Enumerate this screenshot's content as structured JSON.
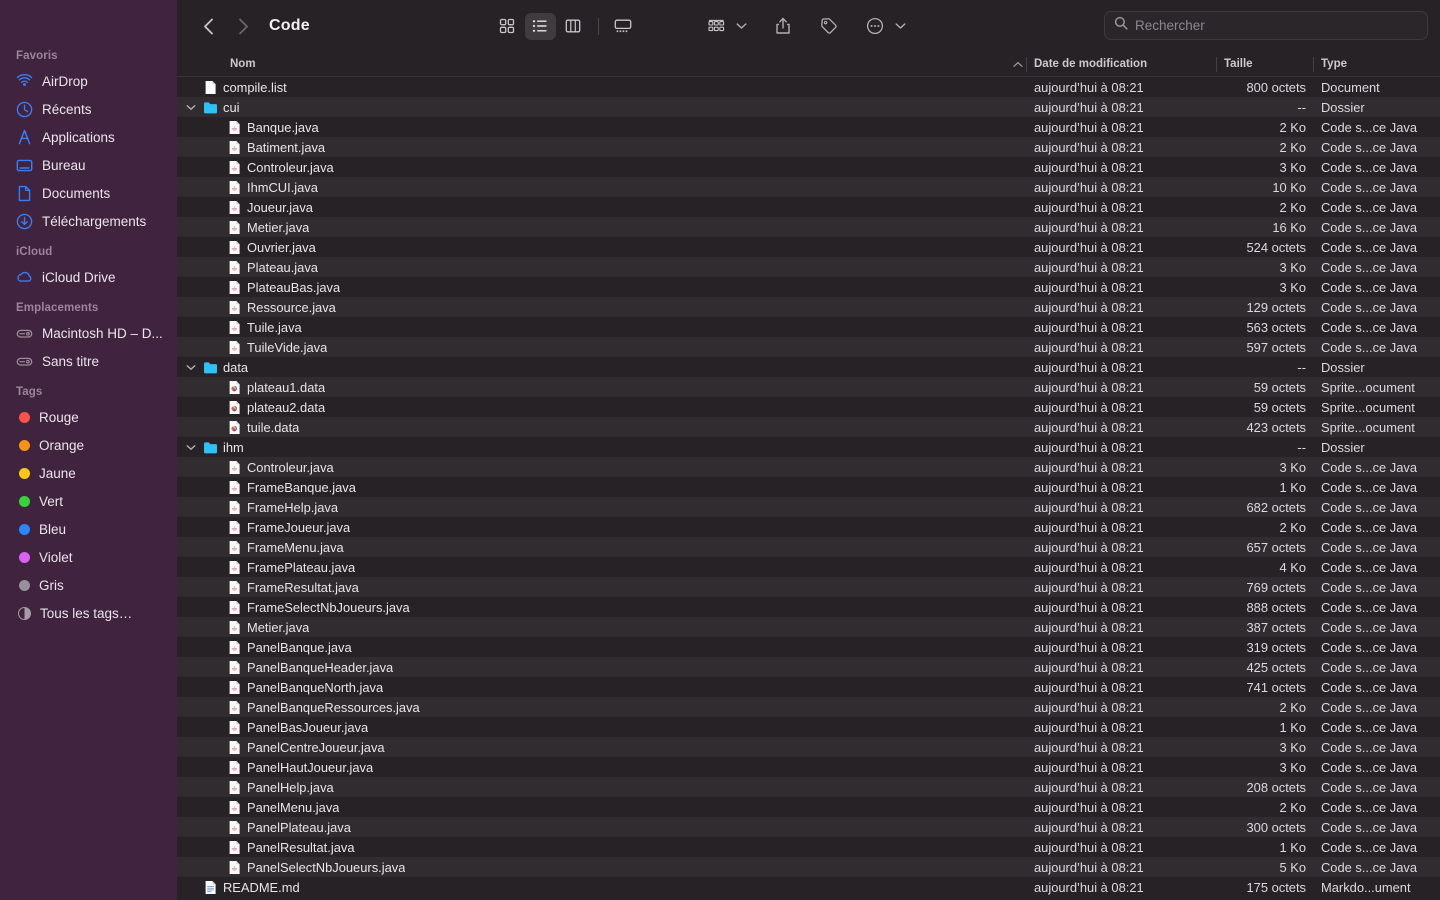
{
  "window": {
    "title": "Code",
    "nav": {
      "back_label": "Précédent",
      "forward_label": "Suivant"
    }
  },
  "toolbar": {
    "view_icon": "icon-view",
    "view_list": "list-view",
    "view_column": "column-view",
    "view_gallery": "gallery-view",
    "group_label": "group-by",
    "share_label": "share",
    "tag_label": "tags",
    "more_label": "more-actions"
  },
  "search": {
    "placeholder": "Rechercher",
    "value": ""
  },
  "sidebar": {
    "sections": [
      {
        "title": "Favoris",
        "items": [
          {
            "label": "AirDrop",
            "icon": "airdrop-icon"
          },
          {
            "label": "Récents",
            "icon": "clock-icon"
          },
          {
            "label": "Applications",
            "icon": "applications-icon"
          },
          {
            "label": "Bureau",
            "icon": "desktop-icon"
          },
          {
            "label": "Documents",
            "icon": "document-icon"
          },
          {
            "label": "Téléchargements",
            "icon": "downloads-icon"
          }
        ]
      },
      {
        "title": "iCloud",
        "items": [
          {
            "label": "iCloud Drive",
            "icon": "cloud-icon"
          }
        ]
      },
      {
        "title": "Emplacements",
        "items": [
          {
            "label": "Macintosh HD – D...",
            "icon": "harddisk-icon"
          },
          {
            "label": "Sans titre",
            "icon": "harddisk-icon"
          }
        ]
      },
      {
        "title": "Tags",
        "items": [
          {
            "label": "Rouge",
            "icon": "tag-dot",
            "color": "#F8544F"
          },
          {
            "label": "Orange",
            "icon": "tag-dot",
            "color": "#F5921B"
          },
          {
            "label": "Jaune",
            "icon": "tag-dot",
            "color": "#FCC717"
          },
          {
            "label": "Vert",
            "icon": "tag-dot",
            "color": "#3BD13B"
          },
          {
            "label": "Bleu",
            "icon": "tag-dot",
            "color": "#2D87F8"
          },
          {
            "label": "Violet",
            "icon": "tag-dot",
            "color": "#D763F0"
          },
          {
            "label": "Gris",
            "icon": "tag-dot",
            "color": "#98909A"
          },
          {
            "label": "Tous les tags…",
            "icon": "all-tags-icon",
            "color": ""
          }
        ]
      }
    ]
  },
  "columns": {
    "name": "Nom",
    "date": "Date de modification",
    "size": "Taille",
    "type": "Type",
    "sort_direction": "ascending"
  },
  "files": [
    {
      "name": "compile.list",
      "indent": 0,
      "kind": "file",
      "icon": "plain-file-icon",
      "date": "aujourd’hui à 08:21",
      "size": "800 octets",
      "type": "Document"
    },
    {
      "name": "cui",
      "indent": 0,
      "kind": "folder",
      "icon": "folder-icon",
      "date": "aujourd’hui à 08:21",
      "size": "--",
      "type": "Dossier",
      "expanded": true
    },
    {
      "name": "Banque.java",
      "indent": 1,
      "kind": "file",
      "icon": "java-file-icon",
      "date": "aujourd’hui à 08:21",
      "size": "2 Ko",
      "type": "Code s...ce Java"
    },
    {
      "name": "Batiment.java",
      "indent": 1,
      "kind": "file",
      "icon": "java-file-icon",
      "date": "aujourd’hui à 08:21",
      "size": "2 Ko",
      "type": "Code s...ce Java"
    },
    {
      "name": "Controleur.java",
      "indent": 1,
      "kind": "file",
      "icon": "java-file-icon",
      "date": "aujourd’hui à 08:21",
      "size": "3 Ko",
      "type": "Code s...ce Java"
    },
    {
      "name": "IhmCUI.java",
      "indent": 1,
      "kind": "file",
      "icon": "java-file-icon",
      "date": "aujourd’hui à 08:21",
      "size": "10 Ko",
      "type": "Code s...ce Java"
    },
    {
      "name": "Joueur.java",
      "indent": 1,
      "kind": "file",
      "icon": "java-file-icon",
      "date": "aujourd’hui à 08:21",
      "size": "2 Ko",
      "type": "Code s...ce Java"
    },
    {
      "name": "Metier.java",
      "indent": 1,
      "kind": "file",
      "icon": "java-file-icon",
      "date": "aujourd’hui à 08:21",
      "size": "16 Ko",
      "type": "Code s...ce Java"
    },
    {
      "name": "Ouvrier.java",
      "indent": 1,
      "kind": "file",
      "icon": "java-file-icon",
      "date": "aujourd’hui à 08:21",
      "size": "524 octets",
      "type": "Code s...ce Java"
    },
    {
      "name": "Plateau.java",
      "indent": 1,
      "kind": "file",
      "icon": "java-file-icon",
      "date": "aujourd’hui à 08:21",
      "size": "3 Ko",
      "type": "Code s...ce Java"
    },
    {
      "name": "PlateauBas.java",
      "indent": 1,
      "kind": "file",
      "icon": "java-file-icon",
      "date": "aujourd’hui à 08:21",
      "size": "3 Ko",
      "type": "Code s...ce Java"
    },
    {
      "name": "Ressource.java",
      "indent": 1,
      "kind": "file",
      "icon": "java-file-icon",
      "date": "aujourd’hui à 08:21",
      "size": "129 octets",
      "type": "Code s...ce Java"
    },
    {
      "name": "Tuile.java",
      "indent": 1,
      "kind": "file",
      "icon": "java-file-icon",
      "date": "aujourd’hui à 08:21",
      "size": "563 octets",
      "type": "Code s...ce Java"
    },
    {
      "name": "TuileVide.java",
      "indent": 1,
      "kind": "file",
      "icon": "java-file-icon",
      "date": "aujourd’hui à 08:21",
      "size": "597 octets",
      "type": "Code s...ce Java"
    },
    {
      "name": "data",
      "indent": 0,
      "kind": "folder",
      "icon": "folder-icon",
      "date": "aujourd’hui à 08:21",
      "size": "--",
      "type": "Dossier",
      "expanded": true
    },
    {
      "name": "plateau1.data",
      "indent": 1,
      "kind": "file",
      "icon": "sprite-file-icon",
      "date": "aujourd’hui à 08:21",
      "size": "59 octets",
      "type": "Sprite...ocument"
    },
    {
      "name": "plateau2.data",
      "indent": 1,
      "kind": "file",
      "icon": "sprite-file-icon",
      "date": "aujourd’hui à 08:21",
      "size": "59 octets",
      "type": "Sprite...ocument"
    },
    {
      "name": "tuile.data",
      "indent": 1,
      "kind": "file",
      "icon": "sprite-file-icon",
      "date": "aujourd’hui à 08:21",
      "size": "423 octets",
      "type": "Sprite...ocument"
    },
    {
      "name": "ihm",
      "indent": 0,
      "kind": "folder",
      "icon": "folder-icon",
      "date": "aujourd’hui à 08:21",
      "size": "--",
      "type": "Dossier",
      "expanded": true
    },
    {
      "name": "Controleur.java",
      "indent": 1,
      "kind": "file",
      "icon": "java-file-icon",
      "date": "aujourd’hui à 08:21",
      "size": "3 Ko",
      "type": "Code s...ce Java"
    },
    {
      "name": "FrameBanque.java",
      "indent": 1,
      "kind": "file",
      "icon": "java-file-icon",
      "date": "aujourd’hui à 08:21",
      "size": "1 Ko",
      "type": "Code s...ce Java"
    },
    {
      "name": "FrameHelp.java",
      "indent": 1,
      "kind": "file",
      "icon": "java-file-icon",
      "date": "aujourd’hui à 08:21",
      "size": "682 octets",
      "type": "Code s...ce Java"
    },
    {
      "name": "FrameJoueur.java",
      "indent": 1,
      "kind": "file",
      "icon": "java-file-icon",
      "date": "aujourd’hui à 08:21",
      "size": "2 Ko",
      "type": "Code s...ce Java"
    },
    {
      "name": "FrameMenu.java",
      "indent": 1,
      "kind": "file",
      "icon": "java-file-icon",
      "date": "aujourd’hui à 08:21",
      "size": "657 octets",
      "type": "Code s...ce Java"
    },
    {
      "name": "FramePlateau.java",
      "indent": 1,
      "kind": "file",
      "icon": "java-file-icon",
      "date": "aujourd’hui à 08:21",
      "size": "4 Ko",
      "type": "Code s...ce Java"
    },
    {
      "name": "FrameResultat.java",
      "indent": 1,
      "kind": "file",
      "icon": "java-file-icon",
      "date": "aujourd’hui à 08:21",
      "size": "769 octets",
      "type": "Code s...ce Java"
    },
    {
      "name": "FrameSelectNbJoueurs.java",
      "indent": 1,
      "kind": "file",
      "icon": "java-file-icon",
      "date": "aujourd’hui à 08:21",
      "size": "888 octets",
      "type": "Code s...ce Java"
    },
    {
      "name": "Metier.java",
      "indent": 1,
      "kind": "file",
      "icon": "java-file-icon",
      "date": "aujourd’hui à 08:21",
      "size": "387 octets",
      "type": "Code s...ce Java"
    },
    {
      "name": "PanelBanque.java",
      "indent": 1,
      "kind": "file",
      "icon": "java-file-icon",
      "date": "aujourd’hui à 08:21",
      "size": "319 octets",
      "type": "Code s...ce Java"
    },
    {
      "name": "PanelBanqueHeader.java",
      "indent": 1,
      "kind": "file",
      "icon": "java-file-icon",
      "date": "aujourd’hui à 08:21",
      "size": "425 octets",
      "type": "Code s...ce Java"
    },
    {
      "name": "PanelBanqueNorth.java",
      "indent": 1,
      "kind": "file",
      "icon": "java-file-icon",
      "date": "aujourd’hui à 08:21",
      "size": "741 octets",
      "type": "Code s...ce Java"
    },
    {
      "name": "PanelBanqueRessources.java",
      "indent": 1,
      "kind": "file",
      "icon": "java-file-icon",
      "date": "aujourd’hui à 08:21",
      "size": "2 Ko",
      "type": "Code s...ce Java"
    },
    {
      "name": "PanelBasJoueur.java",
      "indent": 1,
      "kind": "file",
      "icon": "java-file-icon",
      "date": "aujourd’hui à 08:21",
      "size": "1 Ko",
      "type": "Code s...ce Java"
    },
    {
      "name": "PanelCentreJoueur.java",
      "indent": 1,
      "kind": "file",
      "icon": "java-file-icon",
      "date": "aujourd’hui à 08:21",
      "size": "3 Ko",
      "type": "Code s...ce Java"
    },
    {
      "name": "PanelHautJoueur.java",
      "indent": 1,
      "kind": "file",
      "icon": "java-file-icon",
      "date": "aujourd’hui à 08:21",
      "size": "3 Ko",
      "type": "Code s...ce Java"
    },
    {
      "name": "PanelHelp.java",
      "indent": 1,
      "kind": "file",
      "icon": "java-file-icon",
      "date": "aujourd’hui à 08:21",
      "size": "208 octets",
      "type": "Code s...ce Java"
    },
    {
      "name": "PanelMenu.java",
      "indent": 1,
      "kind": "file",
      "icon": "java-file-icon",
      "date": "aujourd’hui à 08:21",
      "size": "2 Ko",
      "type": "Code s...ce Java"
    },
    {
      "name": "PanelPlateau.java",
      "indent": 1,
      "kind": "file",
      "icon": "java-file-icon",
      "date": "aujourd’hui à 08:21",
      "size": "300 octets",
      "type": "Code s...ce Java"
    },
    {
      "name": "PanelResultat.java",
      "indent": 1,
      "kind": "file",
      "icon": "java-file-icon",
      "date": "aujourd’hui à 08:21",
      "size": "1 Ko",
      "type": "Code s...ce Java"
    },
    {
      "name": "PanelSelectNbJoueurs.java",
      "indent": 1,
      "kind": "file",
      "icon": "java-file-icon",
      "date": "aujourd’hui à 08:21",
      "size": "5 Ko",
      "type": "Code s...ce Java"
    },
    {
      "name": "README.md",
      "indent": 0,
      "kind": "file",
      "icon": "markdown-file-icon",
      "date": "aujourd’hui à 08:21",
      "size": "175 octets",
      "type": "Markdo...ument"
    }
  ],
  "colors": {
    "sidebar_bg": "#40233F",
    "content_bg": "#262225",
    "row_alt_bg": "#302C2F",
    "accent_blue": "#3B7DF5",
    "folder_blue": "#2FC0F5"
  }
}
